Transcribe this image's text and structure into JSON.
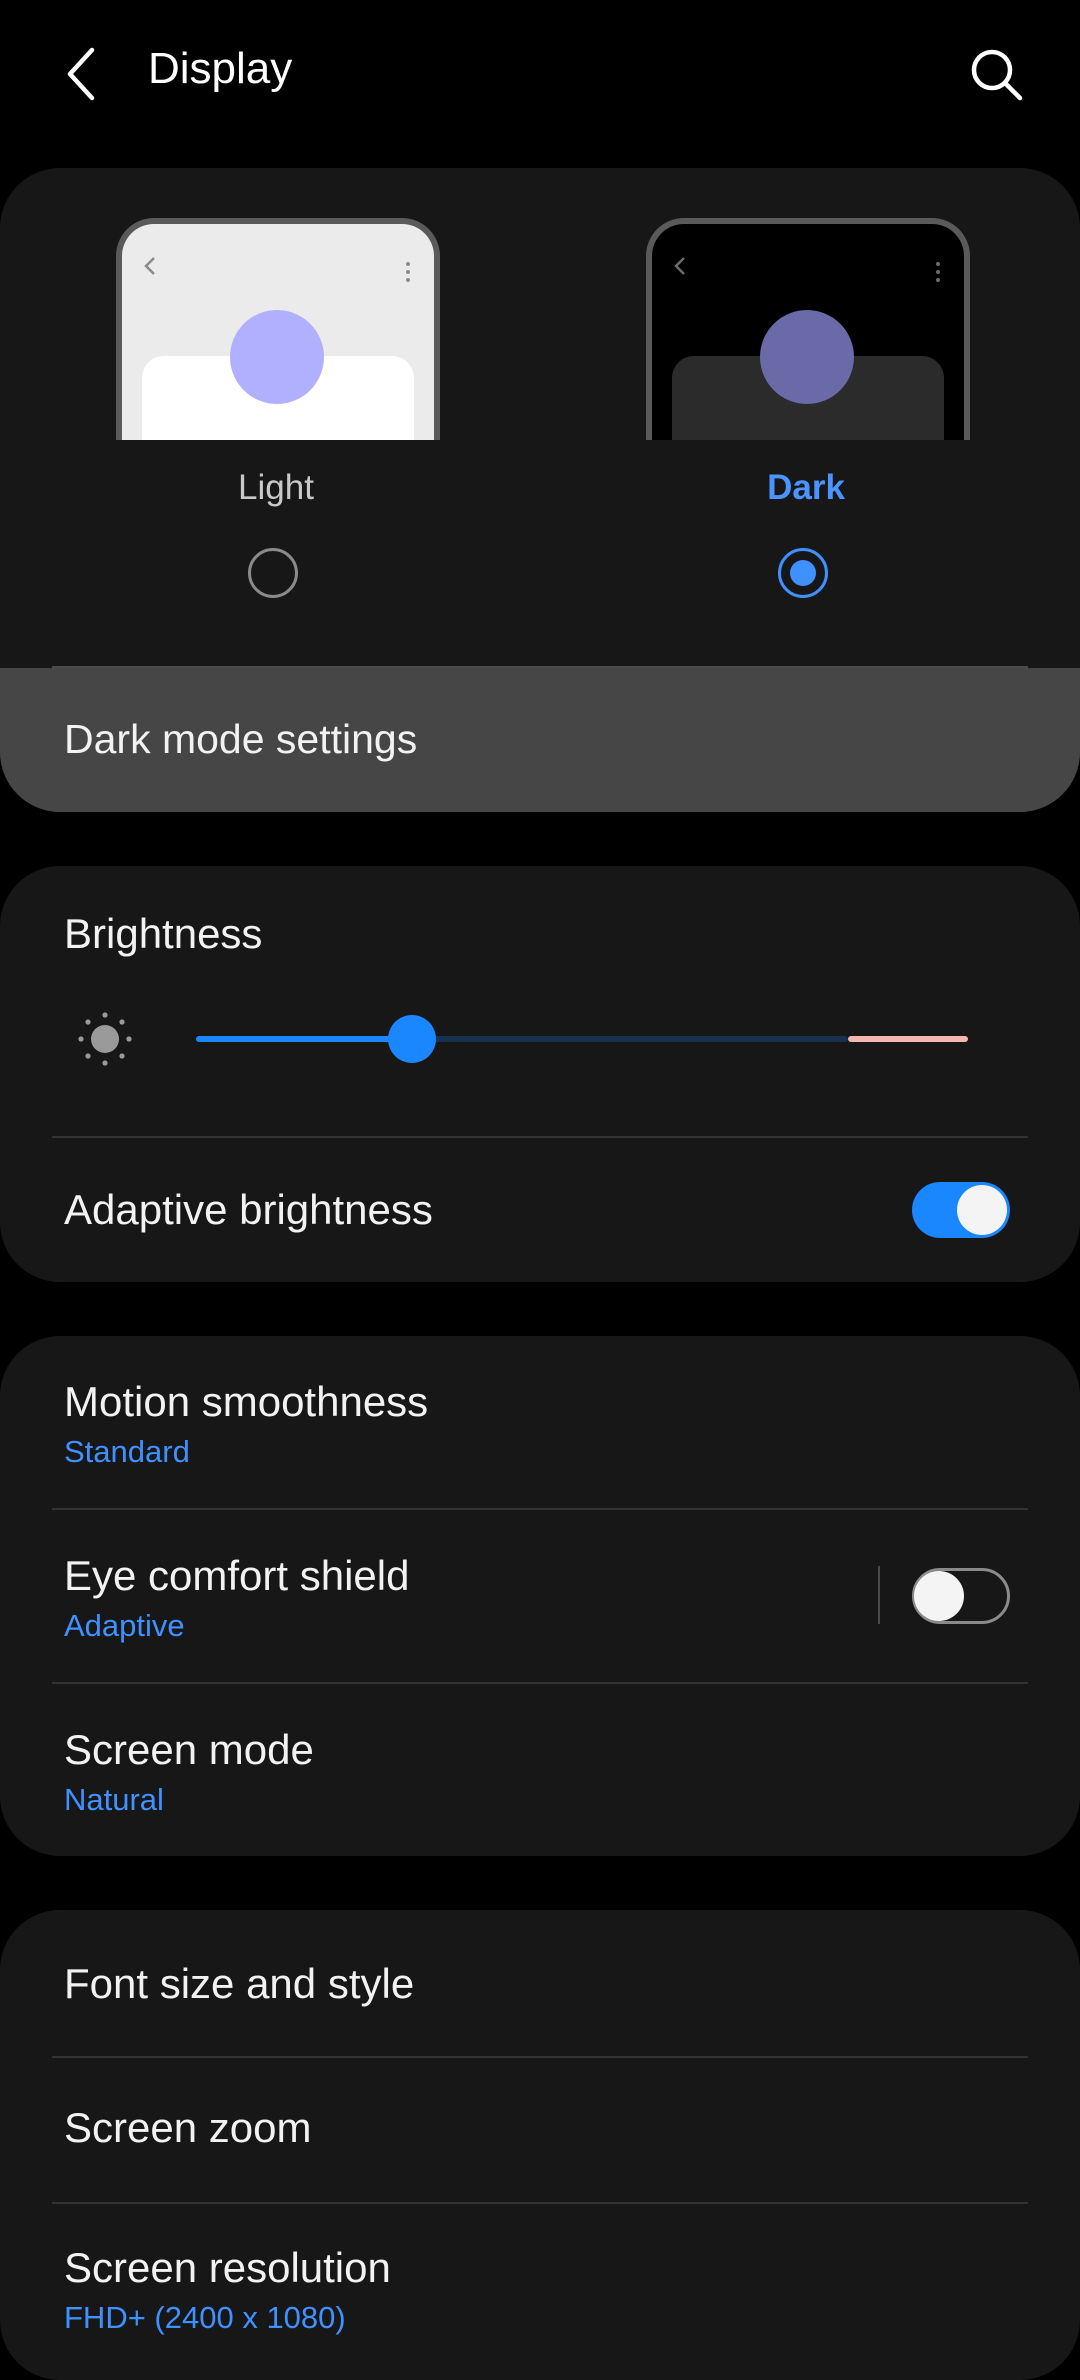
{
  "header": {
    "title": "Display",
    "back_icon": "back-arrow-icon",
    "search_icon": "search-icon"
  },
  "theme": {
    "options": [
      {
        "label": "Light",
        "selected": false
      },
      {
        "label": "Dark",
        "selected": true
      }
    ],
    "dark_mode_settings_label": "Dark mode settings"
  },
  "brightness": {
    "title": "Brightness",
    "icon": "sun-icon",
    "level": 0.28,
    "adaptive_label": "Adaptive brightness",
    "adaptive_on": true
  },
  "motion": {
    "title": "Motion smoothness",
    "subtitle": "Standard"
  },
  "eye_comfort": {
    "title": "Eye comfort shield",
    "subtitle": "Adaptive",
    "on": false
  },
  "screen_mode": {
    "title": "Screen mode",
    "subtitle": "Natural"
  },
  "font": {
    "title": "Font size and style"
  },
  "zoom": {
    "title": "Screen zoom"
  },
  "resolution": {
    "title": "Screen resolution",
    "subtitle": "FHD+ (2400 x 1080)"
  },
  "colors": {
    "accent": "#3e91ff",
    "slider_fill": "#1a86ff",
    "slider_track": "#17324f",
    "slider_warning": "#f2b8b0",
    "card": "#171717",
    "pressed_row": "#464646"
  }
}
